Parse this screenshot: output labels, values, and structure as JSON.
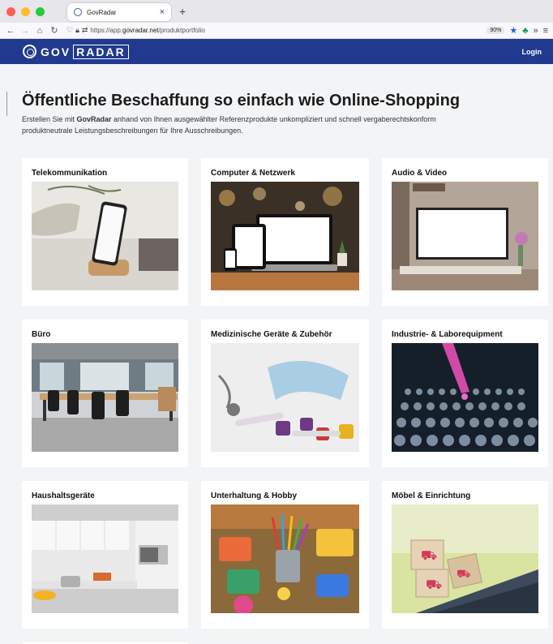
{
  "browser": {
    "tab_title": "GovRadar",
    "tab_close": "×",
    "new_tab": "+",
    "url_prefix": "https://app.",
    "url_domain": "govradar.net",
    "url_path": "/produktportfolio",
    "zoom": "90%",
    "traffic_colors": [
      "#fe5f57",
      "#febc2e",
      "#28c840"
    ]
  },
  "header": {
    "logo_gov": "GOV",
    "logo_radar": "RADAR",
    "login": "Login",
    "bg_color": "#213a8f"
  },
  "main": {
    "title": "Öffentliche Beschaffung so einfach wie Online-Shopping",
    "intro_pre": "Erstellen Sie mit ",
    "intro_bold": "GovRadar",
    "intro_post": " anhand von Ihnen ausgewählter Referenzprodukte unkompliziert und schnell vergaberechtskonform produktneutrale Leistungsbeschreibungen für Ihre Ausschreibungen."
  },
  "categories": [
    {
      "label": "Telekommunikation"
    },
    {
      "label": "Computer & Netzwerk"
    },
    {
      "label": "Audio & Video"
    },
    {
      "label": "Büro"
    },
    {
      "label": "Medizinische Geräte & Zubehör"
    },
    {
      "label": "Industrie- & Laborequipment"
    },
    {
      "label": "Haushaltsgeräte"
    },
    {
      "label": "Unterhaltung & Hobby"
    },
    {
      "label": "Möbel & Einrichtung"
    }
  ]
}
